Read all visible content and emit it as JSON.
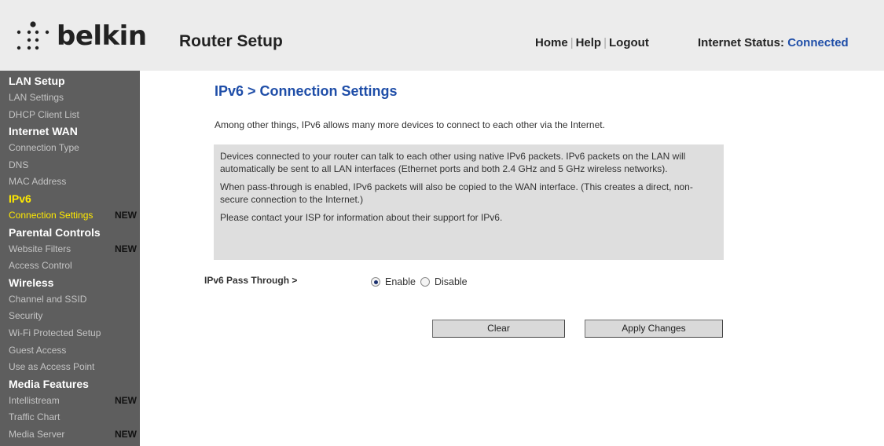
{
  "brand": {
    "logo_text": "belkin"
  },
  "header": {
    "title": "Router Setup",
    "nav": {
      "home": "Home",
      "help": "Help",
      "logout": "Logout",
      "separator": "|"
    },
    "status_label": "Internet Status:",
    "status_value": "Connected"
  },
  "sidebar": {
    "lan_setup": {
      "heading": "LAN Setup",
      "items": [
        "LAN Settings",
        "DHCP Client List"
      ]
    },
    "internet_wan": {
      "heading": "Internet WAN",
      "items": [
        "Connection Type",
        "DNS",
        "MAC Address"
      ]
    },
    "ipv6": {
      "heading": "IPv6",
      "items": [
        "Connection Settings"
      ]
    },
    "parental_controls": {
      "heading": "Parental Controls",
      "items": [
        "Website Filters",
        "Access Control"
      ]
    },
    "wireless": {
      "heading": "Wireless",
      "items": [
        "Channel and SSID",
        "Security",
        "Wi-Fi Protected Setup",
        "Guest Access",
        "Use as Access Point"
      ]
    },
    "media_features": {
      "heading": "Media Features",
      "items": [
        "Intellistream",
        "Traffic Chart",
        "Media Server"
      ]
    },
    "new_badge": "NEW"
  },
  "main": {
    "page_title": "IPv6 > Connection Settings",
    "intro": "Among other things, IPv6 allows many more devices to connect to each other via the Internet.",
    "info": [
      "Devices connected to your router can talk to each other using native IPv6 packets. IPv6 packets on the LAN will automatically be sent to all LAN interfaces (Ethernet ports and both 2.4 GHz and 5 GHz wireless networks).",
      "When pass-through is enabled, IPv6 packets will also be copied to the WAN interface. (This creates a direct, non-secure connection to the Internet.)",
      "Please contact your ISP for information about their support for IPv6."
    ],
    "pass_through_label": "IPv6 Pass Through >",
    "options": {
      "enable": "Enable",
      "disable": "Disable",
      "selected": "Enable"
    },
    "buttons": {
      "clear": "Clear",
      "apply": "Apply Changes"
    }
  },
  "colors": {
    "accent_blue": "#1f4ea8",
    "active_yellow": "#ffea00",
    "sidebar_bg": "#5e5e5e",
    "header_bg": "#ececec",
    "info_box_bg": "#dedede"
  }
}
